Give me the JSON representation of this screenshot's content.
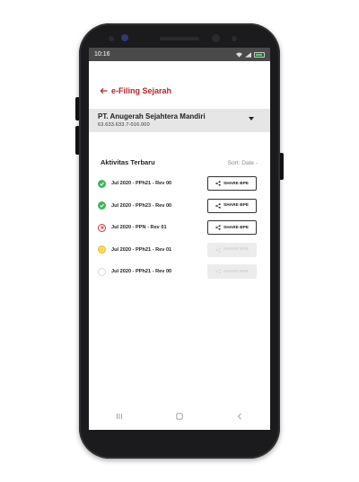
{
  "statusbar": {
    "time": "10:16"
  },
  "header": {
    "title": "e-Filing Sejarah"
  },
  "company": {
    "name": "PT. Anugerah Sejahtera Mandiri",
    "npwp": "63.633.633.7-016.000"
  },
  "activities": {
    "title": "Aktivitas Terbaru",
    "sort_label": "Sort: Date -",
    "items": [
      {
        "label": "Jul 2020 - PPh21 - Rev 00",
        "status": "success",
        "share_label": "SHARE BPE"
      },
      {
        "label": "Jul 2020 - PPh23 - Rev 00",
        "status": "success",
        "share_label": "SHARE BPE"
      },
      {
        "label": "Jul 2020 - PPN - Rev 01",
        "status": "failed",
        "share_label": "SHARE BPE"
      },
      {
        "label": "Jul 2020 - PPh21 - Rev 01",
        "status": "pending",
        "share_label": "SHARE BPE"
      },
      {
        "label": "Jul 2020 - PPh21 - Rev 00",
        "status": "empty",
        "share_label": "SHARE BPE"
      }
    ]
  },
  "colors": {
    "accent": "#b5252a",
    "success": "#3fb55d",
    "failed": "#d9363e",
    "pending": "#f2c230"
  }
}
